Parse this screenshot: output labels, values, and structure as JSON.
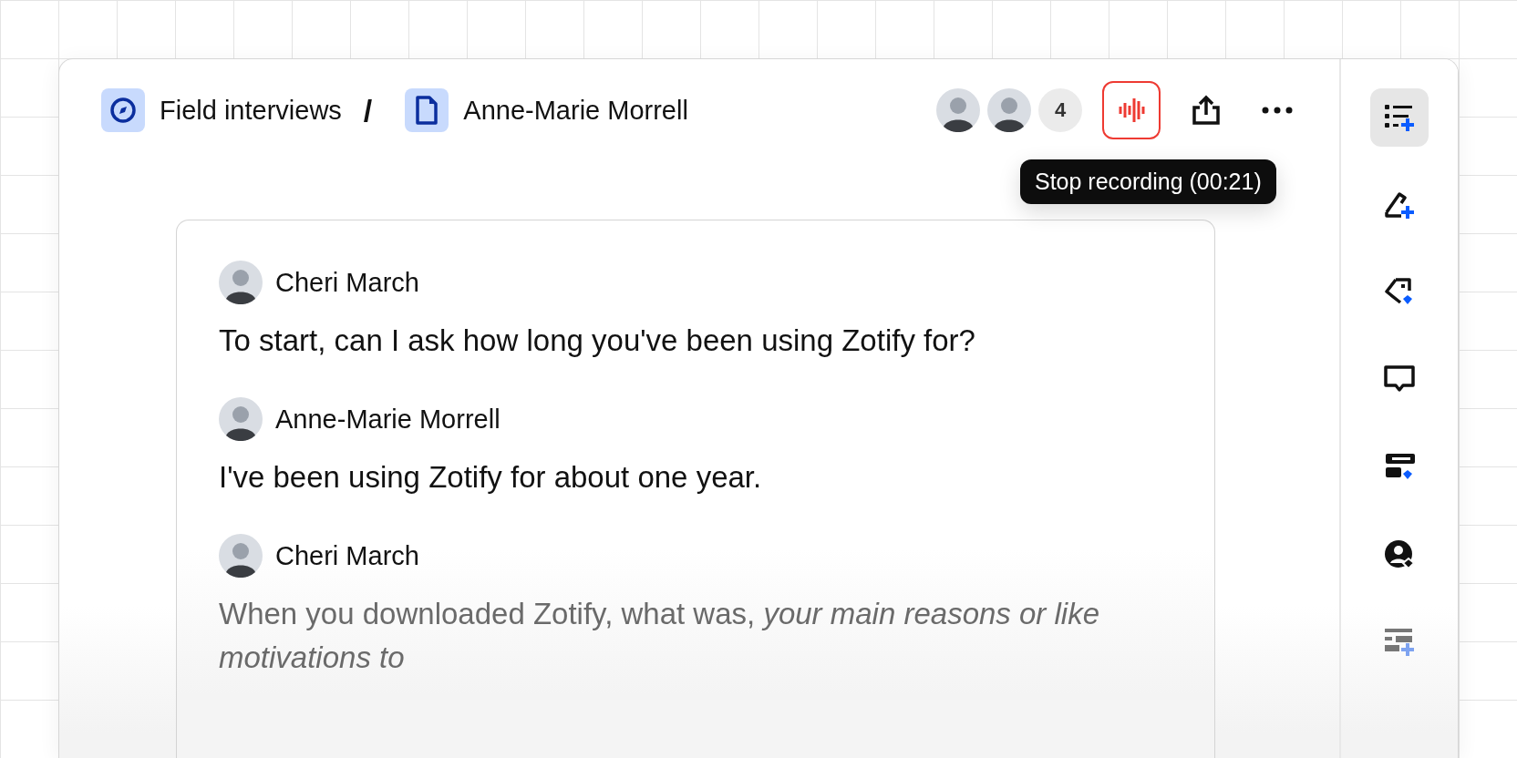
{
  "breadcrumb": {
    "items": [
      {
        "kind": "folder",
        "label": "Field interviews"
      },
      {
        "kind": "document",
        "label": "Anne-Marie Morrell"
      }
    ],
    "separator": "/"
  },
  "collaborators": {
    "avatars": [
      {
        "kind": "photo"
      },
      {
        "kind": "photo"
      }
    ],
    "count": "4"
  },
  "record_button": {
    "recording": true,
    "tooltip": "Stop recording (00:21)"
  },
  "transcript": [
    {
      "speaker": "Cheri March",
      "text": "To start, can I ask how long you've been using Zotify for?",
      "live": false
    },
    {
      "speaker": "Anne-Marie Morrell",
      "text": "I've been using Zotify for about one year.",
      "live": false
    },
    {
      "speaker": "Cheri March",
      "text": "When you downloaded Zotify, what was, *your main reasons or like motivations to*",
      "live": true
    }
  ],
  "sidebar": {
    "items": [
      {
        "kind": "list-add",
        "selected": true
      },
      {
        "kind": "highlight-add",
        "selected": false
      },
      {
        "kind": "tag",
        "selected": false
      },
      {
        "kind": "comment",
        "selected": false
      },
      {
        "kind": "fields",
        "selected": false
      },
      {
        "kind": "person",
        "selected": false
      },
      {
        "kind": "summary-add",
        "selected": false
      }
    ]
  }
}
